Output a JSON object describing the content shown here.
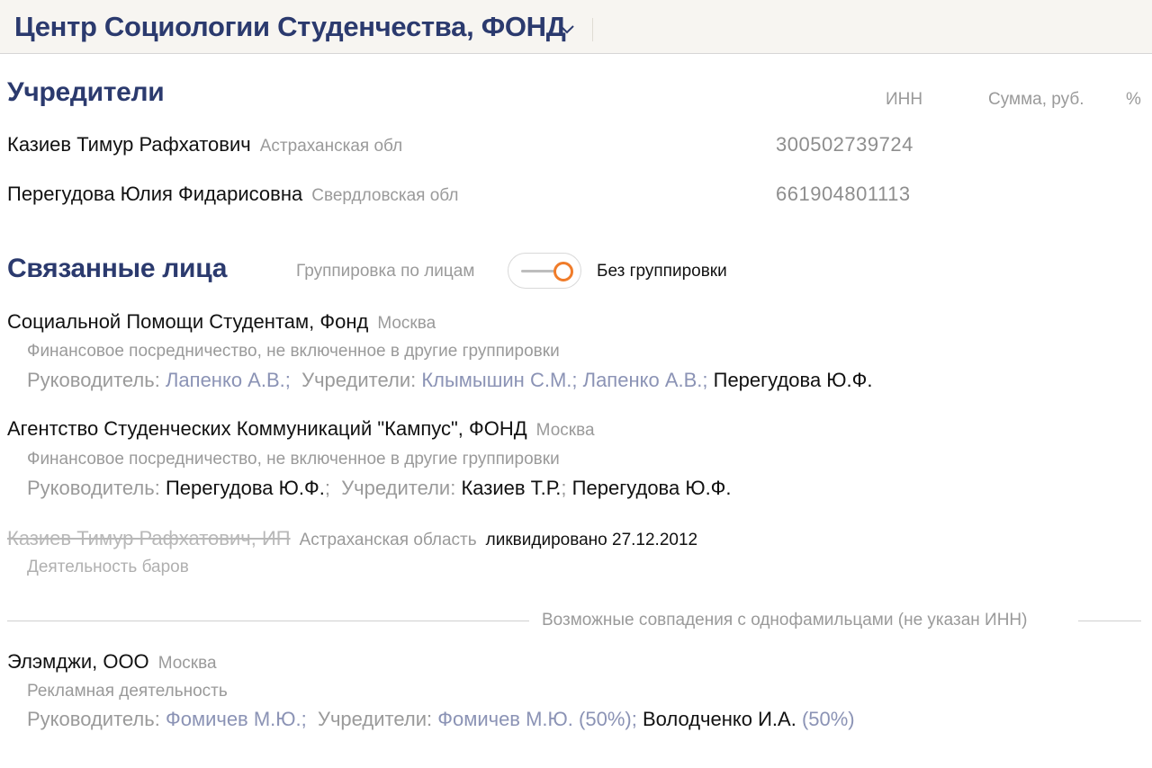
{
  "header": {
    "title": "Центр Социологии Студенчества, ФОНД"
  },
  "founders": {
    "title": "Учредители",
    "columns": {
      "inn": "ИНН",
      "sum": "Сумма, руб.",
      "percent": "%"
    },
    "items": [
      {
        "name": "Казиев Тимур Рафхатович",
        "region": "Астраханская обл",
        "inn": "300502739724"
      },
      {
        "name": "Перегудова Юлия Фидарисовна",
        "region": "Свердловская обл",
        "inn": "661904801113"
      }
    ]
  },
  "related": {
    "title": "Связанные лица",
    "toggle_left": "Группировка по лицам",
    "toggle_right": "Без группировки",
    "items": [
      {
        "name": "Социальной Помощи Студентам, Фонд",
        "region": "Москва",
        "activity": "Финансовое посредничество, не включенное в другие группировки",
        "head_label": "Руководитель:",
        "head": "Лапенко А.В.;",
        "founders_label": "Учредители:",
        "f1": "Клымышин С.М.;",
        "f2": "Лапенко А.В.;",
        "f3": "Перегудова Ю.Ф."
      },
      {
        "name": "Агентство Студенческих Коммуникаций \"Кампус\", ФОНД",
        "region": "Москва",
        "activity": "Финансовое посредничество, не включенное в другие группировки",
        "head_label": "Руководитель:",
        "head": "Перегудова Ю.Ф.",
        "head_sep": ";",
        "founders_label": "Учредители:",
        "f1": "Казиев Т.Р.",
        "f1_sep": ";",
        "f2": "Перегудова Ю.Ф."
      },
      {
        "name": "Казиев Тимур Рафхатович, ИП",
        "region": "Астраханская область",
        "status": "ликвидировано 27.12.2012",
        "activity": "Деятельность баров"
      }
    ]
  },
  "namesakes": {
    "divider": "Возможные совпадения с однофамильцами (не указан ИНН)",
    "items": [
      {
        "name": "Элэмджи, ООО",
        "region": "Москва",
        "activity": "Рекламная деятельность",
        "head_label": "Руководитель:",
        "head": "Фомичев М.Ю.;",
        "founders_label": "Учредители:",
        "f1": "Фомичев М.Ю.",
        "f1_share": "(50%);",
        "f2": "Володченко И.А.",
        "f2_share": "(50%)"
      }
    ]
  }
}
